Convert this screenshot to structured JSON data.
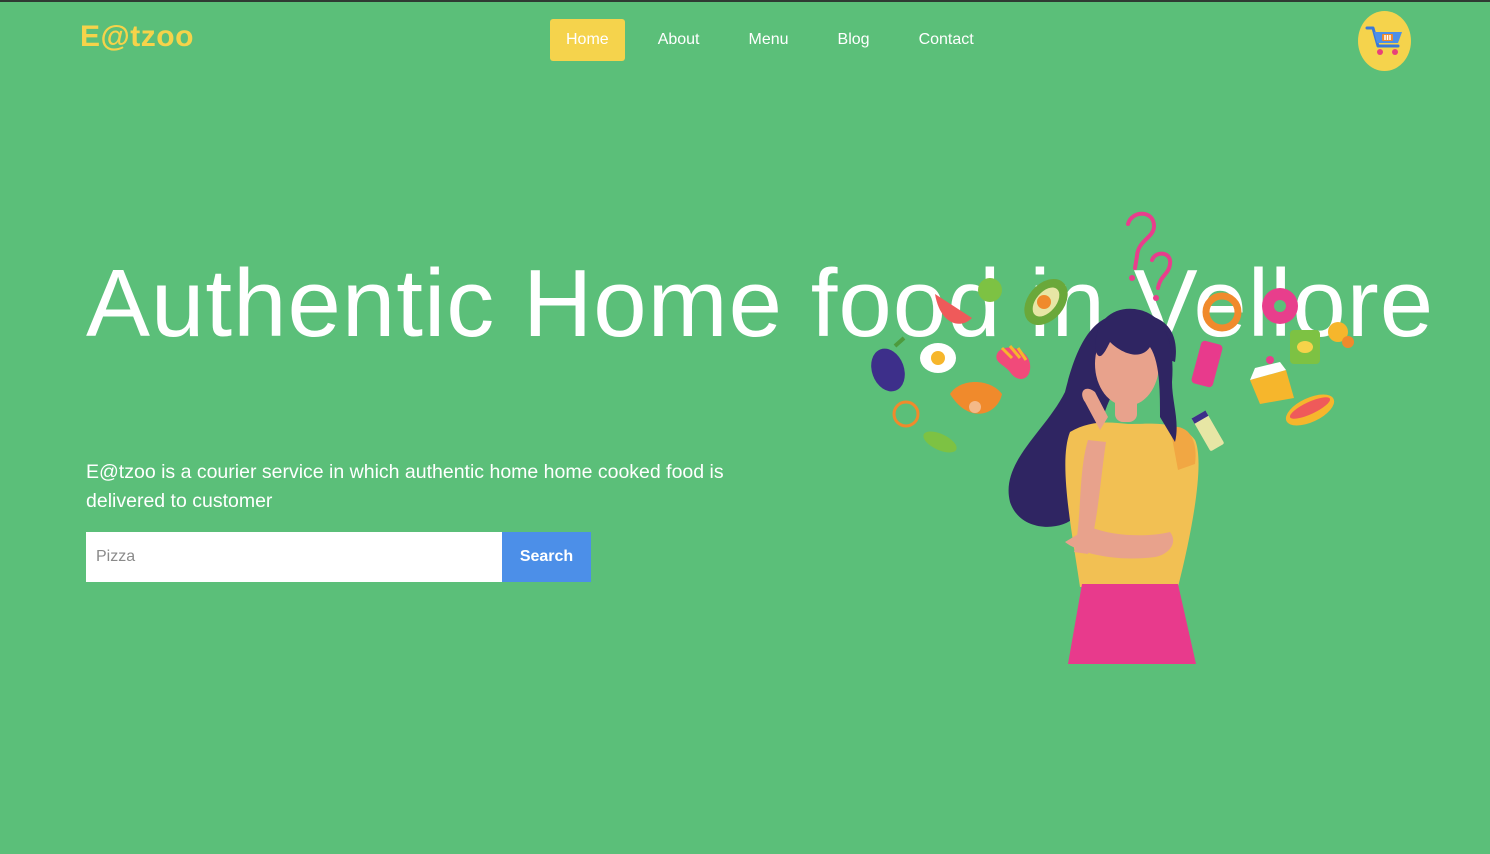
{
  "brand": {
    "logo": "E@tzoo",
    "color": "#f6d34a"
  },
  "nav": {
    "items": [
      {
        "label": "Home",
        "active": true
      },
      {
        "label": "About",
        "active": false
      },
      {
        "label": "Menu",
        "active": false
      },
      {
        "label": "Blog",
        "active": false
      },
      {
        "label": "Contact",
        "active": false
      }
    ]
  },
  "cart": {
    "icon": "shopping-cart-icon"
  },
  "hero": {
    "title": "Authentic Home food in Vellore",
    "description": "E@tzoo is a courier service in which authentic home home cooked food is delivered to customer"
  },
  "search": {
    "placeholder": "Pizza",
    "value": "",
    "button_label": "Search"
  },
  "illustration": {
    "icon": "thinking-woman-food-illustration"
  },
  "colors": {
    "background": "#5bbf79",
    "accent": "#f5d34c",
    "button": "#4c8fe8"
  }
}
